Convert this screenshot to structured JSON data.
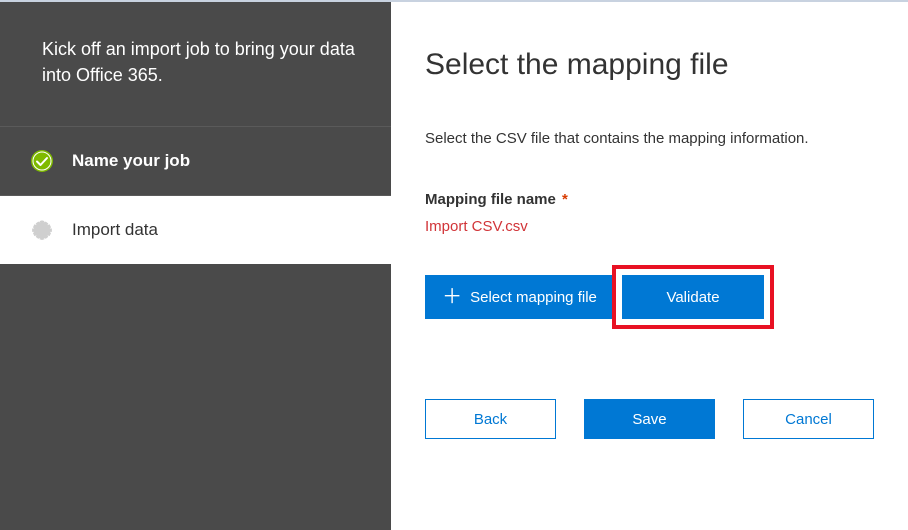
{
  "sidebar": {
    "intro": "Kick off an import job to bring your data into Office 365.",
    "steps": [
      {
        "label": "Name your job",
        "state": "active"
      },
      {
        "label": "Import data",
        "state": "upcoming"
      }
    ]
  },
  "main": {
    "title": "Select the mapping file",
    "description": "Select the CSV file that contains the mapping information.",
    "field_label": "Mapping file name",
    "required_mark": "*",
    "file_name": "Import CSV.csv",
    "select_file_label": "Select mapping file",
    "validate_label": "Validate"
  },
  "footer": {
    "back": "Back",
    "save": "Save",
    "cancel": "Cancel"
  },
  "highlight": {
    "target": "validate-button",
    "color": "#e81123"
  }
}
